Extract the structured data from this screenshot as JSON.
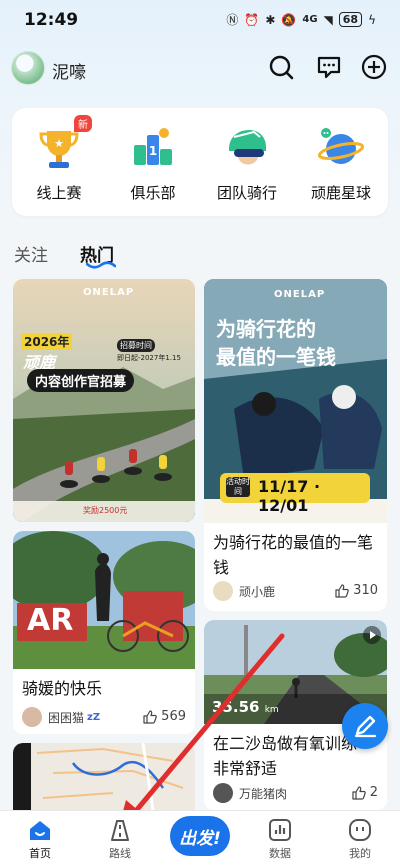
{
  "status_bar": {
    "time": "12:49",
    "network": "4G",
    "battery": "68"
  },
  "header": {
    "username": "泥嚎",
    "icons": [
      "search-icon",
      "message-icon",
      "add-icon"
    ]
  },
  "features": [
    {
      "label": "线上赛",
      "icon": "trophy-icon",
      "badge": "新"
    },
    {
      "label": "俱乐部",
      "icon": "podium-icon"
    },
    {
      "label": "团队骑行",
      "icon": "helmet-icon"
    },
    {
      "label": "顽鹿星球",
      "icon": "planet-icon"
    }
  ],
  "tabs": [
    {
      "label": "关注",
      "active": false
    },
    {
      "label": "热门",
      "active": true
    }
  ],
  "posts": [
    {
      "brand": "ONELAP",
      "img_text": {
        "year": "2026年",
        "name": "顽鹿",
        "recruit": "招募时间",
        "date": "即日起-2027年1.15",
        "headline": "内容创作官招募",
        "footer": "奖励2500元"
      }
    },
    {
      "brand": "ONELAP",
      "img_text": {
        "line1": "为骑行花的",
        "line2": "最值的一笔钱",
        "event_label": "活动时间",
        "event_dates": "11/17 · 12/01"
      },
      "title": "为骑行花的最值的一笔钱",
      "author": "顽小鹿",
      "likes": "310"
    },
    {
      "img_text": {
        "sign": "AR"
      },
      "title": "骑媛的快乐",
      "author": "困困猫",
      "likes": "569"
    },
    {
      "img_text": {
        "speed": "35.56",
        "unit": "km"
      },
      "title": "在二沙岛做有氧训练非常舒适",
      "author": "万能猪肉",
      "likes": "2"
    }
  ],
  "bottom_nav": [
    {
      "label": "首页",
      "active": true
    },
    {
      "label": "路线"
    },
    {
      "label": "出发!"
    },
    {
      "label": "数据"
    },
    {
      "label": "我的"
    }
  ],
  "colors": {
    "accent": "#1a73e8",
    "badge": "#f0453d"
  }
}
